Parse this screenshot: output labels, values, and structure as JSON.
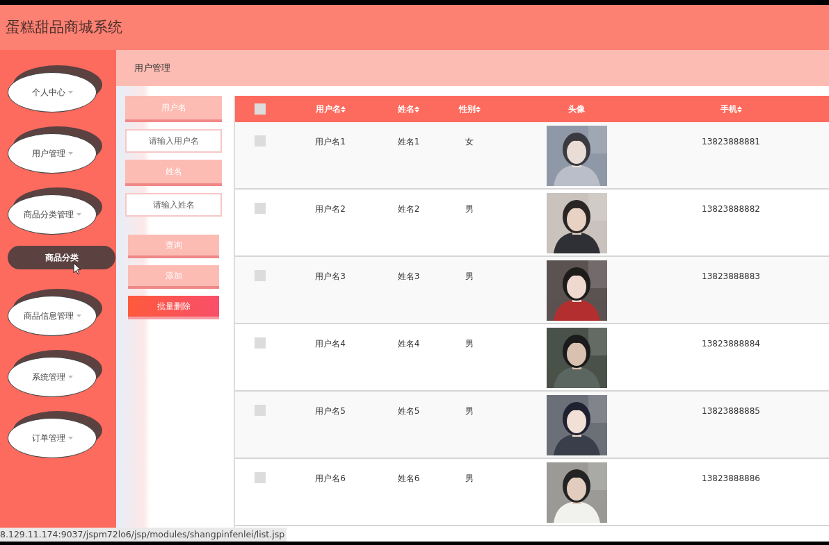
{
  "header": {
    "title": "蛋糕甜品商城系统"
  },
  "sidebar": {
    "items": [
      {
        "label": "个人中心"
      },
      {
        "label": "用户管理"
      },
      {
        "label": "商品分类管理",
        "children": [
          {
            "label": "商品分类",
            "selected": true
          }
        ]
      },
      {
        "label": "商品信息管理"
      },
      {
        "label": "系统管理"
      },
      {
        "label": "订单管理"
      }
    ]
  },
  "breadcrumb": "用户管理",
  "search": {
    "fields": [
      {
        "label": "用户名",
        "placeholder": "请输入用户名"
      },
      {
        "label": "姓名",
        "placeholder": "请输入姓名"
      }
    ],
    "buttons": [
      {
        "label": "查询",
        "kind": "plain"
      },
      {
        "label": "添加",
        "kind": "plain"
      },
      {
        "label": "批量删除",
        "kind": "danger"
      }
    ]
  },
  "table": {
    "header_checked": false,
    "columns": [
      {
        "label": "用户名",
        "sortable": true
      },
      {
        "label": "姓名",
        "sortable": true
      },
      {
        "label": "性别",
        "sortable": true
      },
      {
        "label": "头像",
        "sortable": false
      },
      {
        "label": "手机",
        "sortable": true
      }
    ],
    "rows": [
      {
        "checked": false,
        "username": "用户名1",
        "name": "姓名1",
        "gender": "女",
        "phone": "13823888881"
      },
      {
        "checked": false,
        "username": "用户名2",
        "name": "姓名2",
        "gender": "男",
        "phone": "13823888882"
      },
      {
        "checked": false,
        "username": "用户名3",
        "name": "姓名3",
        "gender": "男",
        "phone": "13823888883"
      },
      {
        "checked": false,
        "username": "用户名4",
        "name": "姓名4",
        "gender": "男",
        "phone": "13823888884"
      },
      {
        "checked": false,
        "username": "用户名5",
        "name": "姓名5",
        "gender": "男",
        "phone": "13823888885"
      },
      {
        "checked": false,
        "username": "用户名6",
        "name": "姓名6",
        "gender": "男",
        "phone": "13823888886"
      }
    ]
  },
  "status_bar": "8.129.11.174:9037/jspm72lo6/jsp/modules/shangpinfenlei/list.jsp"
}
